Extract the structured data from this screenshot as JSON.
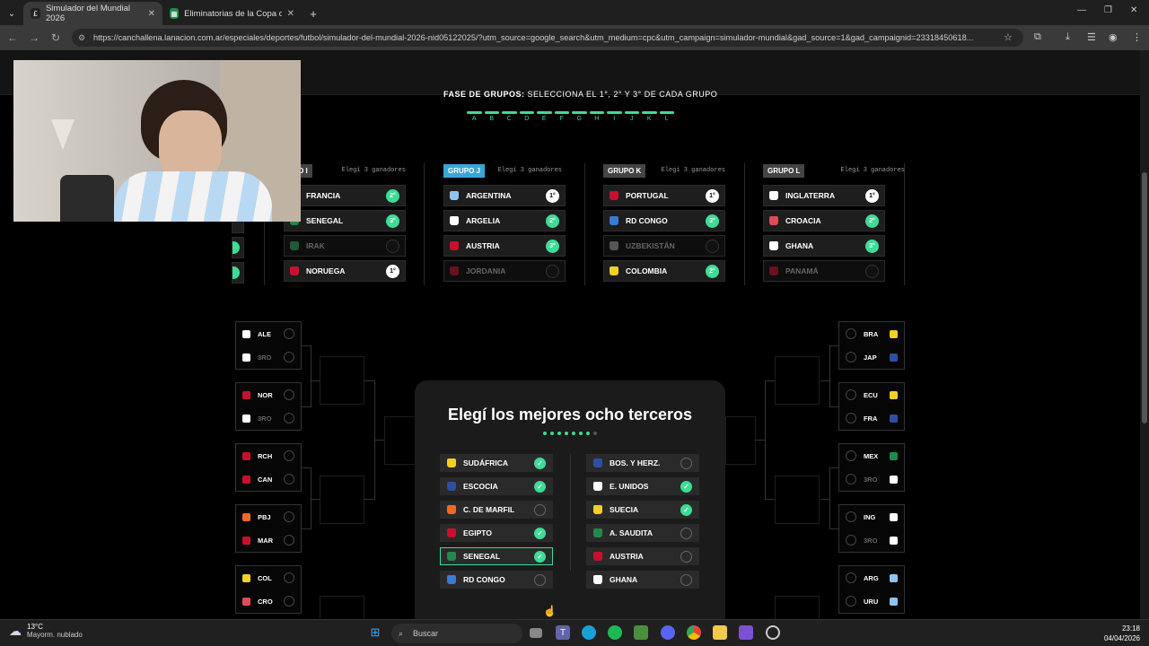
{
  "browser": {
    "tabs": [
      {
        "title": "Simulador del Mundial 2026",
        "active": true
      },
      {
        "title": "Eliminatorias de la Copa del M",
        "active": false
      }
    ],
    "url": "https://canchallena.lanacion.com.ar/especiales/deportes/futbol/simulador-del-mundial-2026-nid05122025/?utm_source=google_search&utm_medium=cpc&utm_campaign=simulador-mundial&gad_source=1&gad_campaignid=23318450618..."
  },
  "phase": {
    "title_bold": "FASE DE GRUPOS:",
    "title_rest": " SELECCIONA EL 1°, 2° Y 3° DE CADA GRUPO",
    "letters": [
      "A",
      "B",
      "C",
      "D",
      "E",
      "F",
      "G",
      "H",
      "I",
      "J",
      "K",
      "L"
    ]
  },
  "groups": [
    {
      "label": "UPO I",
      "hint": "Elegí 3 ganadores",
      "selected": false,
      "teams": [
        {
          "name": "FRANCIA",
          "rank": "2°",
          "color": "#ffffff"
        },
        {
          "name": "SENEGAL",
          "rank": "3°",
          "color": "#1f8a4c"
        },
        {
          "name": "IRAK",
          "rank": "",
          "color": "#1f8a4c"
        },
        {
          "name": "NORUEGA",
          "rank": "1°",
          "color": "#c8102e"
        }
      ]
    },
    {
      "label": "GRUPO J",
      "hint": "Elegí 3 ganadores",
      "selected": true,
      "teams": [
        {
          "name": "ARGENTINA",
          "rank": "1°",
          "color": "#8ec5f0"
        },
        {
          "name": "ARGELIA",
          "rank": "2°",
          "color": "#ffffff"
        },
        {
          "name": "AUSTRIA",
          "rank": "3°",
          "color": "#c8102e"
        },
        {
          "name": "JORDANIA",
          "rank": "",
          "color": "#c8102e"
        }
      ]
    },
    {
      "label": "GRUPO K",
      "hint": "Elegí 3 ganadores",
      "selected": false,
      "teams": [
        {
          "name": "PORTUGAL",
          "rank": "1°",
          "color": "#c8102e"
        },
        {
          "name": "RD CONGO",
          "rank": "3°",
          "color": "#3a7bd5"
        },
        {
          "name": "UZBEKISTÁN",
          "rank": "",
          "color": "#ffffff"
        },
        {
          "name": "COLOMBIA",
          "rank": "2°",
          "color": "#f2d024"
        }
      ]
    },
    {
      "label": "GRUPO L",
      "hint": "Elegí 3 ganadores",
      "selected": false,
      "teams": [
        {
          "name": "INGLATERRA",
          "rank": "1°",
          "color": "#ffffff"
        },
        {
          "name": "CROACIA",
          "rank": "2°",
          "color": "#e04b5a"
        },
        {
          "name": "GHANA",
          "rank": "3°",
          "color": "#ffffff"
        },
        {
          "name": "PANAMÁ",
          "rank": "",
          "color": "#c8102e"
        }
      ]
    }
  ],
  "bracket_left": [
    {
      "a": "ALE",
      "b": "3RO",
      "ca": "#ffffff",
      "cb": "#ffffff"
    },
    {
      "a": "NOR",
      "b": "3RO",
      "ca": "#c8102e",
      "cb": "#ffffff"
    },
    {
      "a": "RCH",
      "b": "CAN",
      "ca": "#c8102e",
      "cb": "#c8102e"
    },
    {
      "a": "PBJ",
      "b": "MAR",
      "ca": "#f26a21",
      "cb": "#c8102e"
    },
    {
      "a": "COL",
      "b": "CRO",
      "ca": "#f2d024",
      "cb": "#e04b5a"
    }
  ],
  "bracket_right": [
    {
      "a": "BRA",
      "b": "JAP",
      "ca": "#f2d024",
      "cb": "#2d4fa0"
    },
    {
      "a": "ECU",
      "b": "FRA",
      "ca": "#f2d024",
      "cb": "#2d4fa0"
    },
    {
      "a": "MEX",
      "b": "3RO",
      "ca": "#1f8a4c",
      "cb": "#ffffff"
    },
    {
      "a": "ING",
      "b": "3RO",
      "ca": "#ffffff",
      "cb": "#ffffff"
    },
    {
      "a": "ARG",
      "b": "URU",
      "ca": "#8ec5f0",
      "cb": "#8ec5f0"
    }
  ],
  "modal": {
    "title": "Elegí los mejores ocho terceros",
    "dots_on": 7,
    "dots_total": 8,
    "left": [
      {
        "name": "SUDÁFRICA",
        "checked": true,
        "color": "#f2d024"
      },
      {
        "name": "ESCOCIA",
        "checked": true,
        "color": "#2d4fa0"
      },
      {
        "name": "C. DE MARFIL",
        "checked": false,
        "color": "#f26a21"
      },
      {
        "name": "EGIPTO",
        "checked": true,
        "color": "#c8102e"
      },
      {
        "name": "SENEGAL",
        "checked": true,
        "color": "#1f8a4c",
        "highlight": true
      },
      {
        "name": "RD CONGO",
        "checked": false,
        "color": "#3a7bd5"
      }
    ],
    "right": [
      {
        "name": "BOS. Y HERZ.",
        "checked": false,
        "color": "#2d4fa0"
      },
      {
        "name": "E. UNIDOS",
        "checked": true,
        "color": "#ffffff"
      },
      {
        "name": "SUECIA",
        "checked": true,
        "color": "#f2d024"
      },
      {
        "name": "A. SAUDITA",
        "checked": false,
        "color": "#1f8a4c"
      },
      {
        "name": "AUSTRIA",
        "checked": false,
        "color": "#c8102e"
      },
      {
        "name": "GHANA",
        "checked": false,
        "color": "#ffffff"
      }
    ]
  },
  "taskbar": {
    "weather_temp": "13°C",
    "weather_desc": "Mayorm. nublado",
    "search": "Buscar",
    "time": "23:18",
    "date": "04/04/2026"
  }
}
